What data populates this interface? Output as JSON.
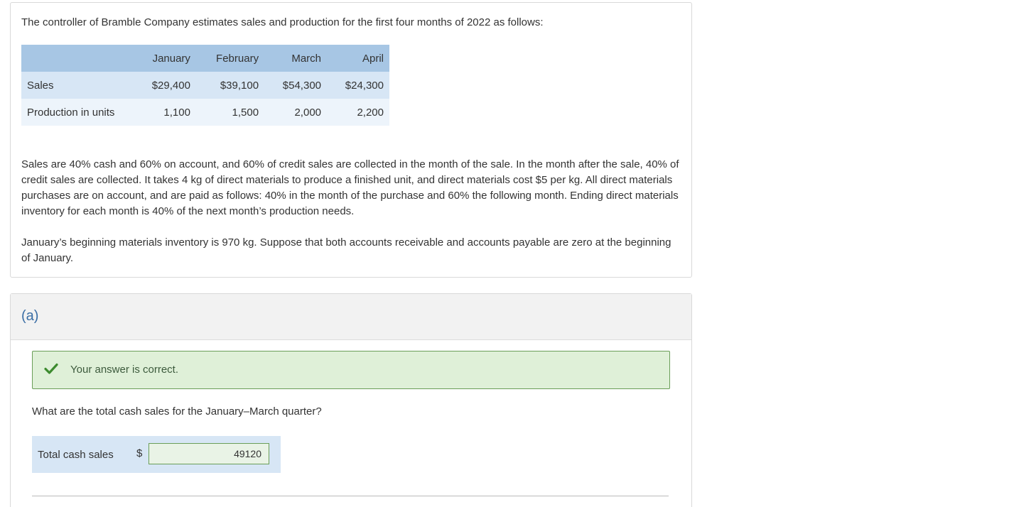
{
  "problem": {
    "intro": "The controller of Bramble Company estimates sales and production for the first four months of 2022 as follows:",
    "table": {
      "columns": [
        "January",
        "February",
        "March",
        "April"
      ],
      "rows": [
        {
          "label": "Sales",
          "values": [
            "$29,400",
            "$39,100",
            "$54,300",
            "$24,300"
          ]
        },
        {
          "label": "Production in units",
          "values": [
            "1,100",
            "1,500",
            "2,000",
            "2,200"
          ]
        }
      ]
    },
    "paragraph1": "Sales are 40% cash and 60% on account, and 60% of credit sales are collected in the month of the sale. In the month after the sale, 40% of credit sales are collected. It takes 4 kg of direct materials to produce a finished unit, and direct materials cost $5 per kg. All direct materials purchases are on account, and are paid as follows: 40% in the month of the purchase and 60% the following month. Ending direct materials inventory for each month is 40% of the next month’s production needs.",
    "paragraph2": "January’s beginning materials inventory is 970 kg. Suppose that both accounts receivable and accounts payable are zero at the beginning of January."
  },
  "part_a": {
    "label": "(a)",
    "feedback": "Your answer is correct.",
    "question": "What are the total cash sales for the January–March quarter?",
    "answer_label": "Total cash sales",
    "currency": "$",
    "answer_value": "49120"
  },
  "colors": {
    "table_header": "#a7c6e4",
    "table_row_1": "#d7e6f5",
    "table_row_2": "#edf4fb",
    "correct_bg": "#dff0d8",
    "correct_border": "#6a9e58",
    "part_label": "#3a6ea5"
  },
  "icons": {
    "feedback": "check-icon"
  }
}
